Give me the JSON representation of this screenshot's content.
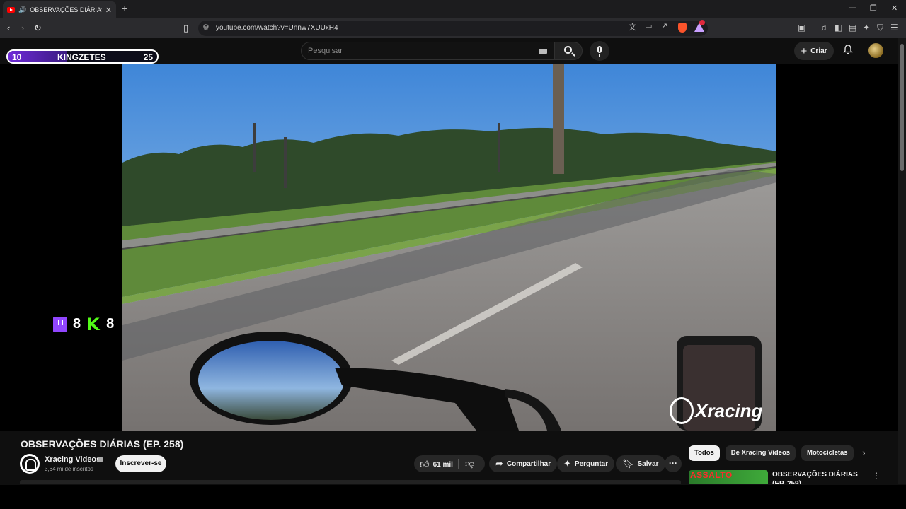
{
  "browser": {
    "tab_title": "OBSERVAÇÕES DIÁRIAS (EP. 258)",
    "new_tab": "+",
    "url": "youtube.com/watch?v=Unnw7XUUxH4"
  },
  "youtube_header": {
    "search_placeholder": "Pesquisar",
    "create_label": "Criar"
  },
  "overlay": {
    "scoreboard": {
      "left": "10",
      "name": "KINGZETES",
      "right": "25",
      "fill_fraction": 0.4
    },
    "twitch_count": "8",
    "kick_count": "8",
    "watermark": "Xracing"
  },
  "video": {
    "title": "OBSERVAÇÕES DIÁRIAS (EP. 258)",
    "channel_name": "Xracing Videos",
    "subscribers": "3,64 mi de inscritos",
    "subscribe_label": "Inscrever-se",
    "likes": "61 mil",
    "share_label": "Compartilhar",
    "ask_label": "Perguntar",
    "save_label": "Salvar"
  },
  "sidebar": {
    "chips": [
      "Todos",
      "De Xracing Videos",
      "Motocicletas"
    ],
    "recommended": {
      "thumb_text": "ASSALTO",
      "title": "OBSERVAÇÕES DIÁRIAS (EP. 259)"
    }
  },
  "colors": {
    "youtube_red": "#ff0000",
    "twitch_purple": "#9146ff",
    "kick_green": "#53fc18",
    "brave_orange": "#fb542b"
  }
}
